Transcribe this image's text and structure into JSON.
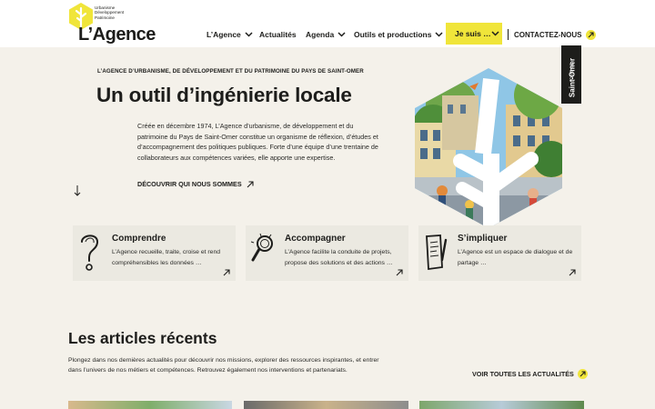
{
  "header": {
    "logo": {
      "small_text": "Urbanisme\nDéveloppement\nPatrimoine",
      "wordmark": "L’Agence"
    },
    "nav": [
      {
        "label": "L’Agence",
        "has_dropdown": true
      },
      {
        "label": "Actualités",
        "has_dropdown": false
      },
      {
        "label": "Agenda",
        "has_dropdown": true
      },
      {
        "label": "Outils et productions",
        "has_dropdown": true
      }
    ],
    "je_suis_label": "Je suis …",
    "contact_label": "CONTACTEZ-NOUS"
  },
  "hero": {
    "kicker": "L’AGENCE D’URBANISME, DE DÉVELOPPEMENT ET DU PATRIMOINE DU PAYS DE SAINT-OMER",
    "title": "Un outil d’ingénierie locale",
    "text": "Créée en décembre 1974, L’Agence d’urbanisme, de développement et du patrimoine du Pays de Saint-Omer constitue un organisme de réflexion, d’études et d’accompagnement des politiques publiques. Forte d’une équipe d’une trentaine de collaborateurs aux compétences variées, elle apporte une expertise.",
    "link_label": "DÉCOUVRIR QUI NOUS SOMMES"
  },
  "tag": {
    "small": "PAYS DE",
    "big": "Saint-Omer"
  },
  "cards": [
    {
      "title": "Comprendre",
      "text": "L’Agence recueille, traite, croise et rend compréhensibles les données …",
      "icon": "question-mark-icon"
    },
    {
      "title": "Accompagner",
      "text": "L’Agence facilite la conduite de projets, propose des solutions et des actions …",
      "icon": "magnifier-icon"
    },
    {
      "title": "S’impliquer",
      "text": "L’Agence est un espace de dialogue et de partage …",
      "icon": "document-pen-icon"
    }
  ],
  "articles": {
    "title": "Les articles récents",
    "text": "Plongez dans nos dernières actualités pour découvrir nos missions, explorer des ressources inspirantes, et entrer dans l’univers de nos métiers et compétences. Retrouvez également nos interventions et partenariats.",
    "all_label": "VOIR TOUTES LES ACTUALITÉS"
  },
  "colors": {
    "accent": "#f0e53a",
    "text": "#1d1d1b",
    "background": "#f4f1ea",
    "card": "#ebe9e1"
  }
}
